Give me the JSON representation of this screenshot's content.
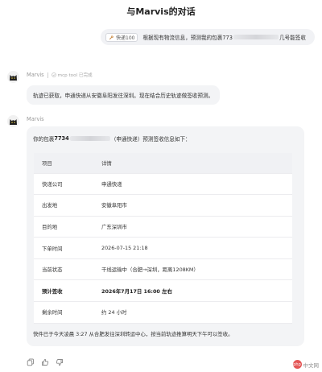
{
  "header": {
    "title": "与Marvis的对话"
  },
  "user_message": {
    "chip_label": "快递100",
    "text_before": "根据现有物流信息，预测我的包裹773",
    "text_after": "几号能签收"
  },
  "agent": {
    "name": "Marvis",
    "tool_label": "mcp tool 已完成"
  },
  "message_1": {
    "text": "轨迹已获取，申通快递从安徽阜阳发往深圳。现在结合历史轨迹做签收预测。"
  },
  "message_2": {
    "intro_before": "你的包裹 ",
    "intro_bold": "7734",
    "intro_after": "（申通快递）预测签收信息如下：",
    "table": {
      "headers": [
        "项目",
        "详情"
      ],
      "rows": [
        {
          "k": "快递公司",
          "v": "申通快递",
          "bold": false
        },
        {
          "k": "出发地",
          "v": "安徽阜阳市",
          "bold": false
        },
        {
          "k": "目的地",
          "v": "广东深圳市",
          "bold": false
        },
        {
          "k": "下单时间",
          "v": "2026-07-15 21:18",
          "bold": false
        },
        {
          "k": "当前状态",
          "v": "干线运输中（合肥→深圳，距离1208KM）",
          "bold": false
        },
        {
          "k": "预计签收",
          "v": "2026年7月17日 16:00 左右",
          "bold": true
        },
        {
          "k": "剩余时间",
          "v": "约 24 小时",
          "bold": false
        }
      ]
    },
    "footer": "快件已于今天凌晨 3:27 从合肥发往深圳转运中心，按当前轨迹推算明天下午可以签收。"
  },
  "watermark": {
    "text": "中文网",
    "logo_text": "php"
  },
  "icons": {
    "tool_icon": "wrench-icon",
    "status_icon": "check-icon",
    "copy_icon": "copy-icon",
    "like_icon": "thumbs-up-icon",
    "dislike_icon": "thumbs-down-icon"
  }
}
